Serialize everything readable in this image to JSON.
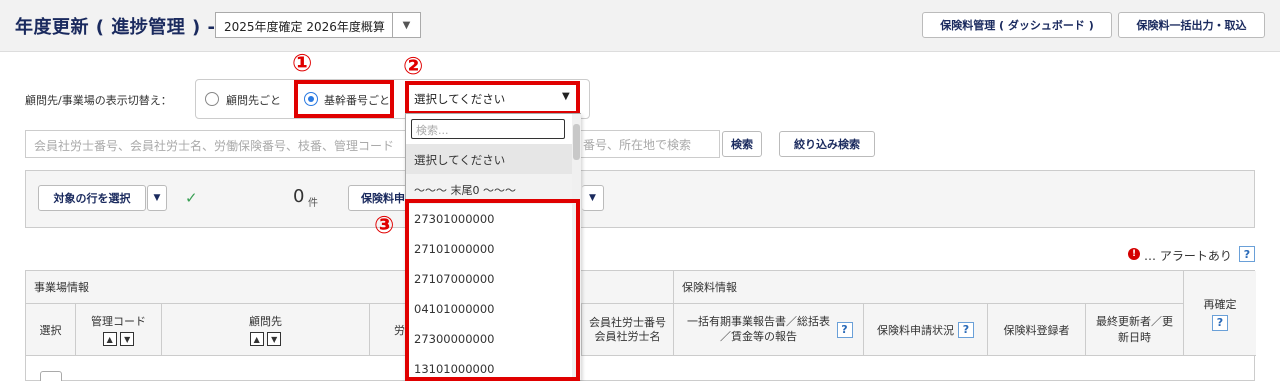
{
  "header": {
    "title": "年度更新 ( 進捗管理 ) -",
    "year_select": "2025年度確定 2026年度概算",
    "dashboard_button": "保険料管理 ( ダッシュボード )",
    "export_button": "保険料一括出力・取込"
  },
  "toggle": {
    "label": "顧問先/事業場の表示切替え：",
    "option_client": "顧問先ごと",
    "option_base": "基幹番号ごと",
    "select_value": "選択してください"
  },
  "annotations": {
    "n1": "①",
    "n2": "②",
    "n3": "③"
  },
  "search": {
    "placeholder": "会員社労士番号、会員社労士名、労働保険番号、枝番、管理コード",
    "placeholder_tail": "番号、所在地で検索",
    "search_button": "検索",
    "filter_button": "絞り込み検索"
  },
  "action_panel": {
    "select_rows": "対象の行を選択",
    "count": "0",
    "count_unit": "件",
    "insurance_button": "保険料申"
  },
  "dropdown": {
    "search_placeholder": "検索...",
    "items": [
      "選択してください",
      "～～～ 末尾0 ～～～",
      "27301000000",
      "27101000000",
      "27107000000",
      "04101000000",
      "27300000000",
      "13101000000"
    ]
  },
  "alert": {
    "text": "… アラートあり"
  },
  "table": {
    "group_site": "事業場情報",
    "group_insurance": "保険料情報",
    "col_select": "選択",
    "col_code": "管理コード",
    "col_client": "顧問先",
    "col_labor": "労",
    "col_member": "会員社労士番号\n会員社労士名",
    "col_report": "一括有期事業報告書／総括表／賃金等の報告",
    "col_status": "保険料申請状況",
    "col_registrant": "保険料登録者",
    "col_updated": "最終更新者／更新日時",
    "col_reconfirm": "再確定"
  }
}
